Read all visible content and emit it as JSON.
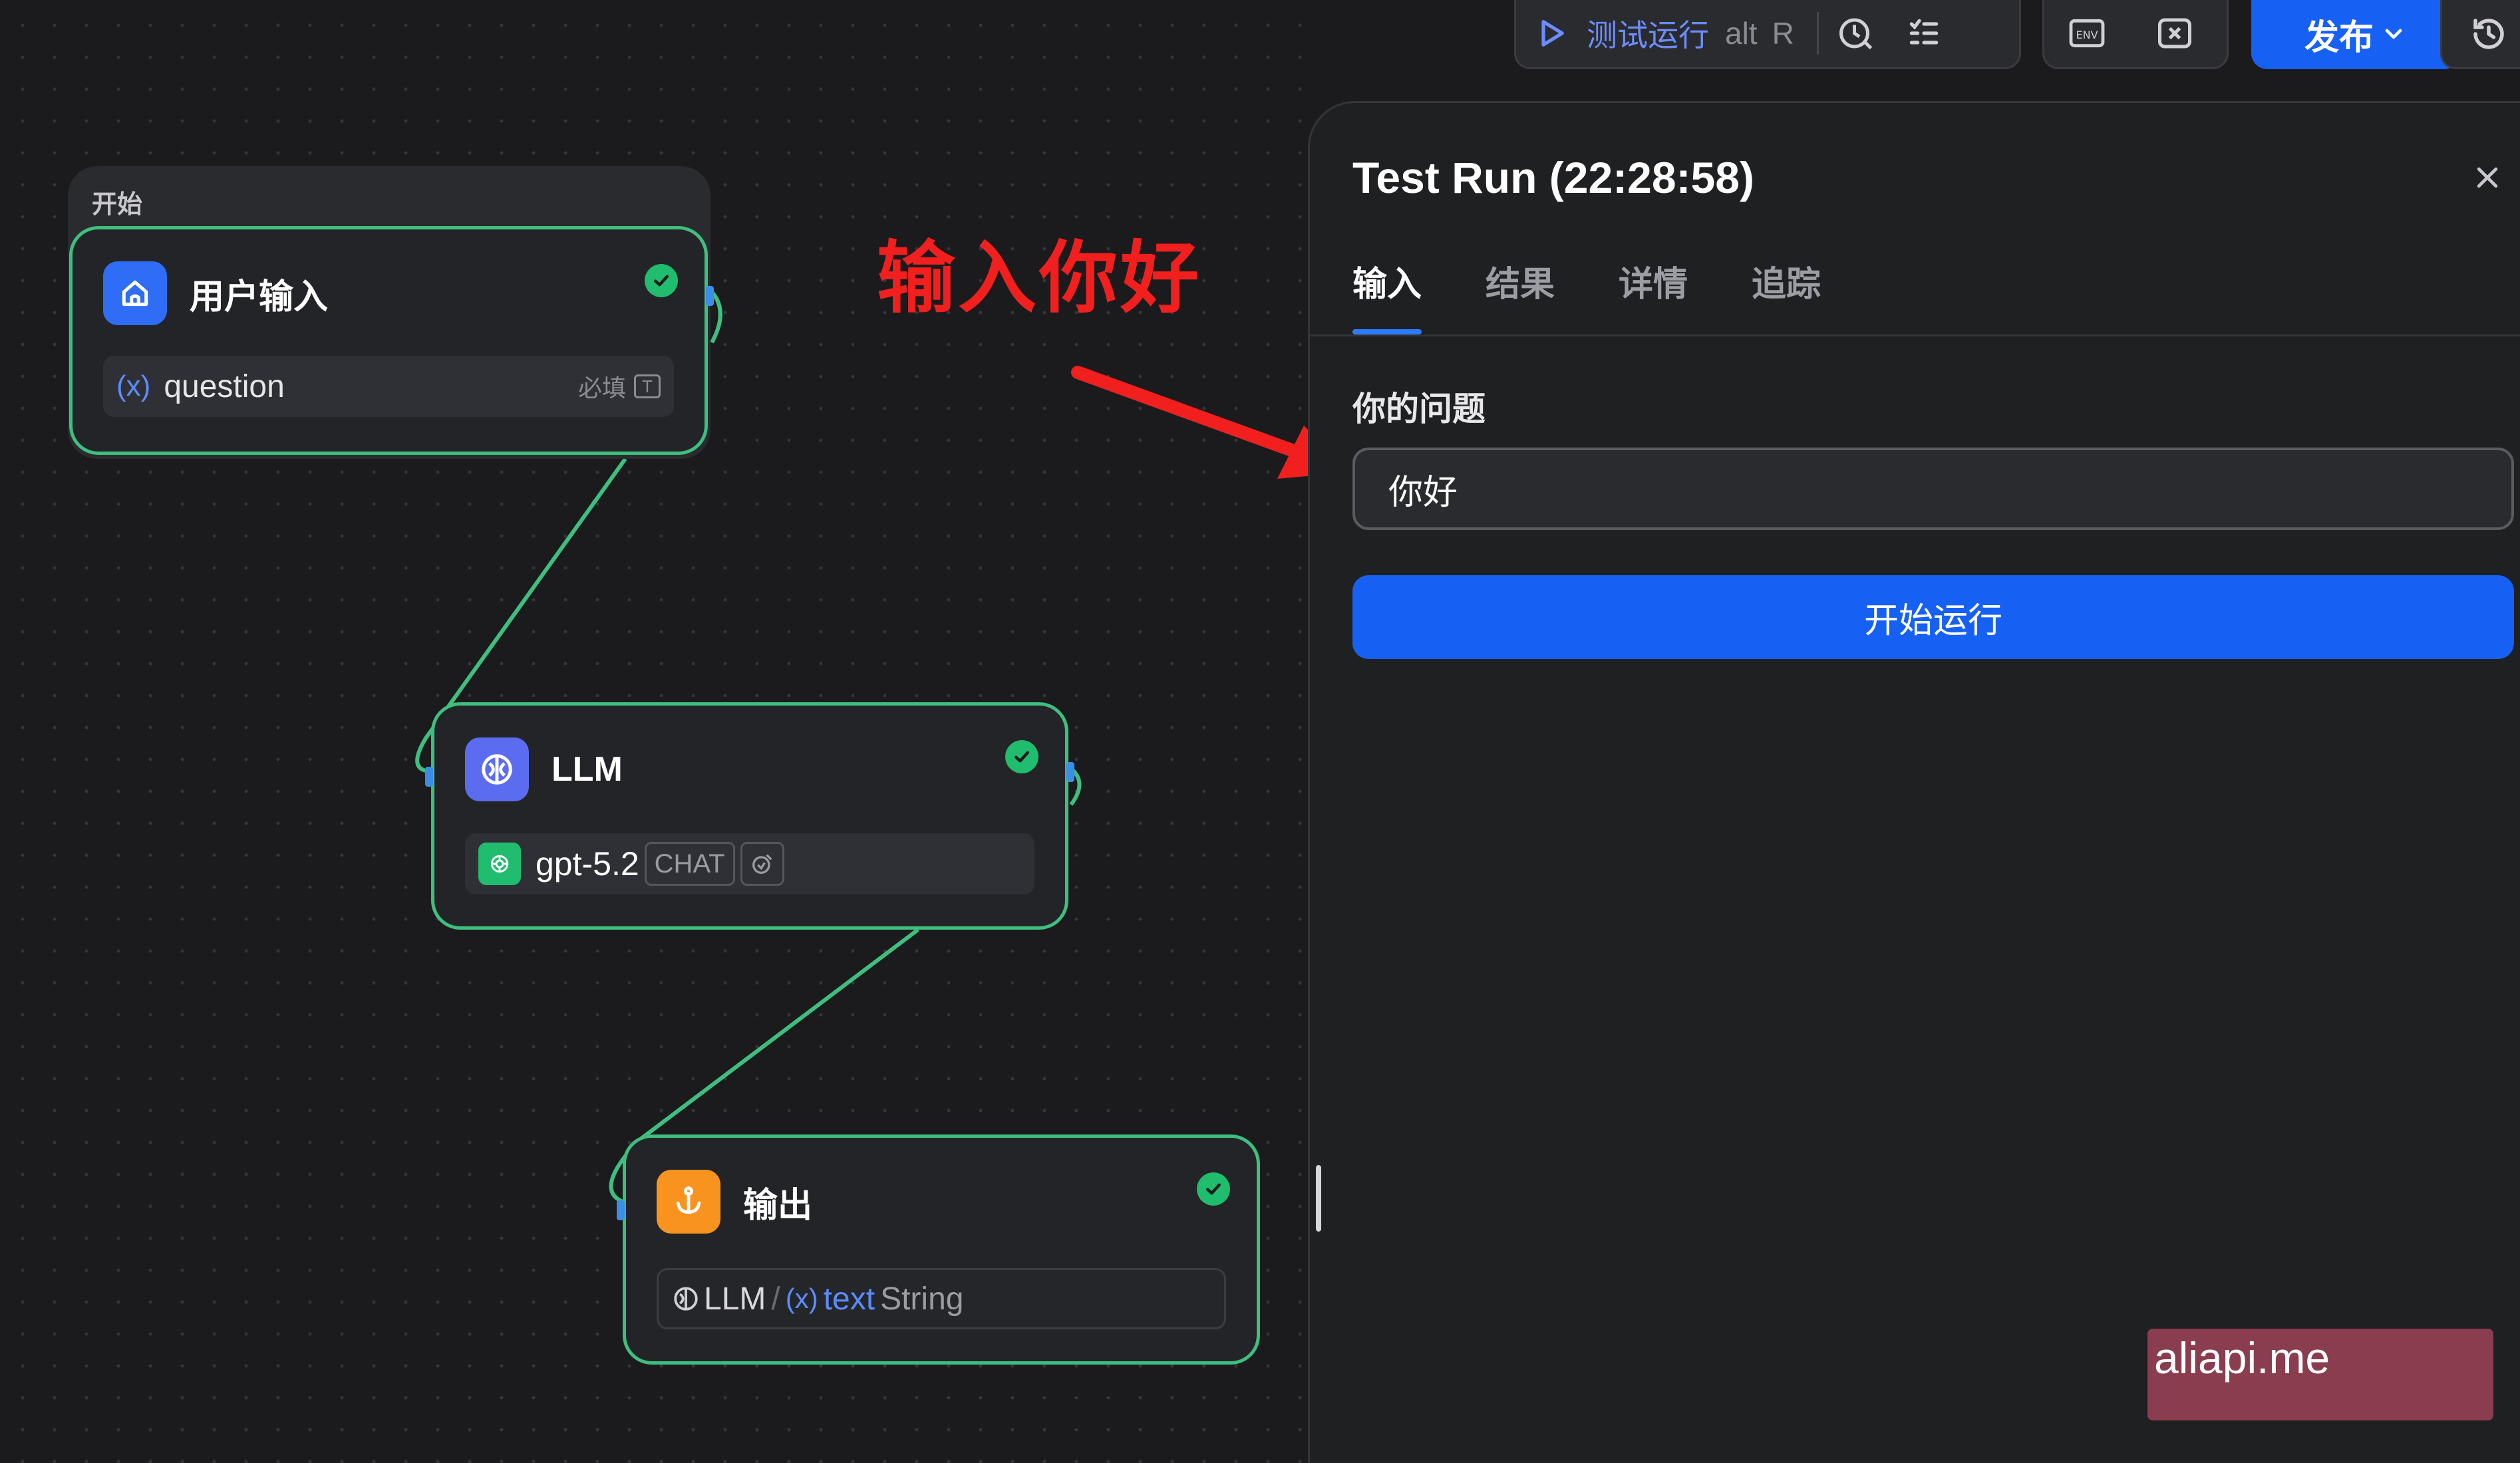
{
  "toolbar": {
    "test_run_label": "测试运行",
    "shortcut_alt": "alt",
    "shortcut_key": "R",
    "publish_label": "发布"
  },
  "canvas": {
    "start_group_label": "开始",
    "nodes": {
      "user_input": {
        "title": "用户输入",
        "var_prefix": "(x)",
        "var_name": "question",
        "required_label": "必填"
      },
      "llm": {
        "title": "LLM",
        "model": "gpt-5.2",
        "mode_tag": "CHAT"
      },
      "output": {
        "title": "输出",
        "ref_node": "LLM",
        "separator": "/",
        "var_prefix": "(x)",
        "var_name": "text",
        "var_type": "String"
      }
    },
    "annotation": "输入你好"
  },
  "panel": {
    "title": "Test Run (22:28:58)",
    "tabs": [
      {
        "label": "输入",
        "active": true
      },
      {
        "label": "结果",
        "active": false
      },
      {
        "label": "详情",
        "active": false
      },
      {
        "label": "追踪",
        "active": false
      }
    ],
    "field_label": "你的问题",
    "input_value": "你好",
    "run_button_label": "开始运行"
  },
  "watermark": "aliapi.me",
  "colors": {
    "accent_blue": "#1760f4",
    "success_green": "#1fbd6d",
    "edge_green": "#3fbf7f",
    "annotation_red": "#f21f1f",
    "llm_purple": "#5b6cf0",
    "output_orange": "#f7931e"
  }
}
